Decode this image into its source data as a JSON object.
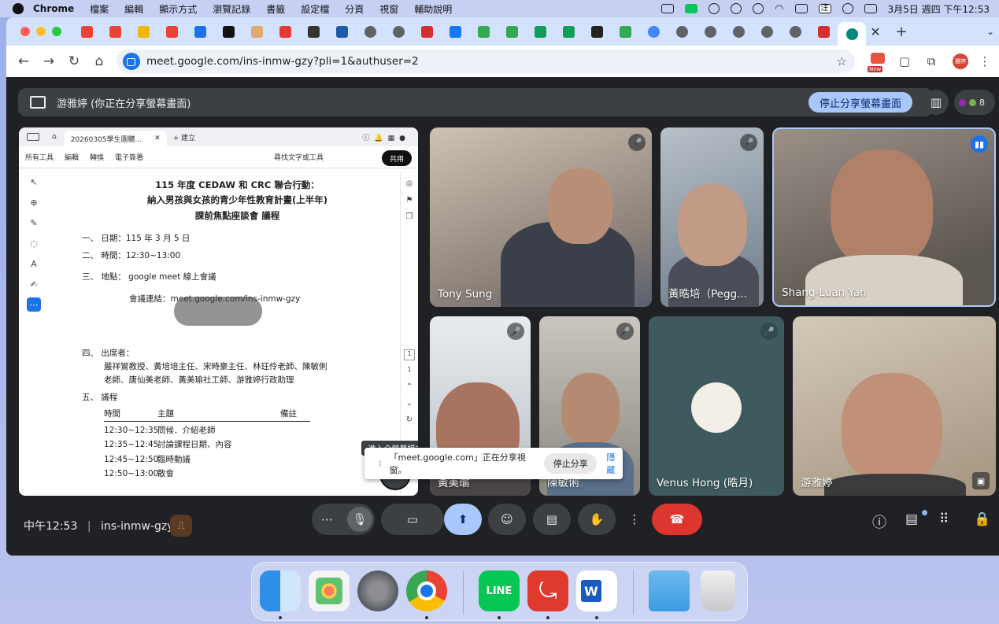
{
  "menubar": {
    "app": "Chrome",
    "items": [
      "檔案",
      "編輯",
      "顯示方式",
      "瀏覽記錄",
      "書籤",
      "設定檔",
      "分頁",
      "視窗",
      "輔助說明"
    ],
    "input_method": "注",
    "datetime": "3月5日 週四 下午12:53"
  },
  "browser": {
    "url": "meet.google.com/ins-inmw-gzy?pli=1&authuser=2",
    "new_badge": "New",
    "profile_label": "雅婷",
    "tab_favicons": [
      "gmail",
      "gmail",
      "slides",
      "gmail",
      "calendar",
      "notion",
      "misc",
      "pdf",
      "pocket",
      "markdown",
      "globe",
      "globe",
      "acrobat",
      "facebook",
      "drive",
      "drive",
      "sheets",
      "classroom",
      "gallery",
      "drive",
      "google",
      "globe",
      "globe",
      "globe",
      "globe",
      "globe",
      "acrobat",
      "meet"
    ]
  },
  "meet": {
    "share_banner": "游雅婷 (你正在分享螢幕畫面)",
    "stop_share_label": "停止分享螢幕畫面",
    "participant_count": "8",
    "clock": "中午12:53",
    "meeting_code": "ins-inmw-gzy",
    "fullscreen_tooltip": "進入全螢幕模式",
    "share_notice": {
      "text": "「meet.google.com」正在分享視窗。",
      "stop": "停止分享",
      "hide": "隱藏"
    },
    "participants": [
      {
        "name": "Tony Sung",
        "muted": true
      },
      {
        "name": "黃晧培（Pegg...",
        "muted": true
      },
      {
        "name": "Shang-Luan Yan",
        "muted": false
      },
      {
        "name": "黃美瑜",
        "muted": true
      },
      {
        "name": "陳敏俐",
        "muted": true
      },
      {
        "name": "Venus Hong (晧月)",
        "muted": true
      },
      {
        "name": "游雅婷",
        "muted": false
      }
    ]
  },
  "pdf": {
    "tab_title": "20260305學生團體...",
    "new_tab": "+ 建立",
    "menu": [
      "所有工具",
      "編輯",
      "轉換",
      "電子簽署"
    ],
    "search": "尋找文字或工具",
    "share": "共用",
    "title_lines": [
      "115 年度 CEDAW 和 CRC 聯合行動：",
      "納入男孩與女孩的青少年性教育計畫(上半年)",
      "課前焦點座談會  議程"
    ],
    "items": [
      "一、  日期：115 年 3 月 5 日",
      "二、  時間：12:30~13:00",
      "三、  地點： google meet 線上會議"
    ],
    "link_line": "會議連結：meet.google.com/ins-inmw-gzy",
    "attendees_label": "四、  出席者：",
    "attendees": [
      "嚴祥鸞教授、黃培培主任、宋時豪主任、林玨伶老師、陳敏俐",
      "老師、唐仙美老師、黃美瑜社工師、游雅婷行政助理"
    ],
    "agenda_label": "五、  議程",
    "agenda_headers": [
      "時間",
      "主題",
      "備註"
    ],
    "agenda_rows": [
      [
        "12:30~12:35",
        "問候．介紹老師"
      ],
      [
        "12:35~12:45",
        "討論課程日期、內容"
      ],
      [
        "12:45~12:50",
        "臨時動議"
      ],
      [
        "12:50~13:00",
        "散會"
      ]
    ],
    "page_number": "1",
    "page_total": "1"
  },
  "dock": [
    "finder",
    "launchpad",
    "system-settings",
    "chrome",
    "line",
    "acrobat",
    "word",
    "downloads",
    "trash"
  ]
}
